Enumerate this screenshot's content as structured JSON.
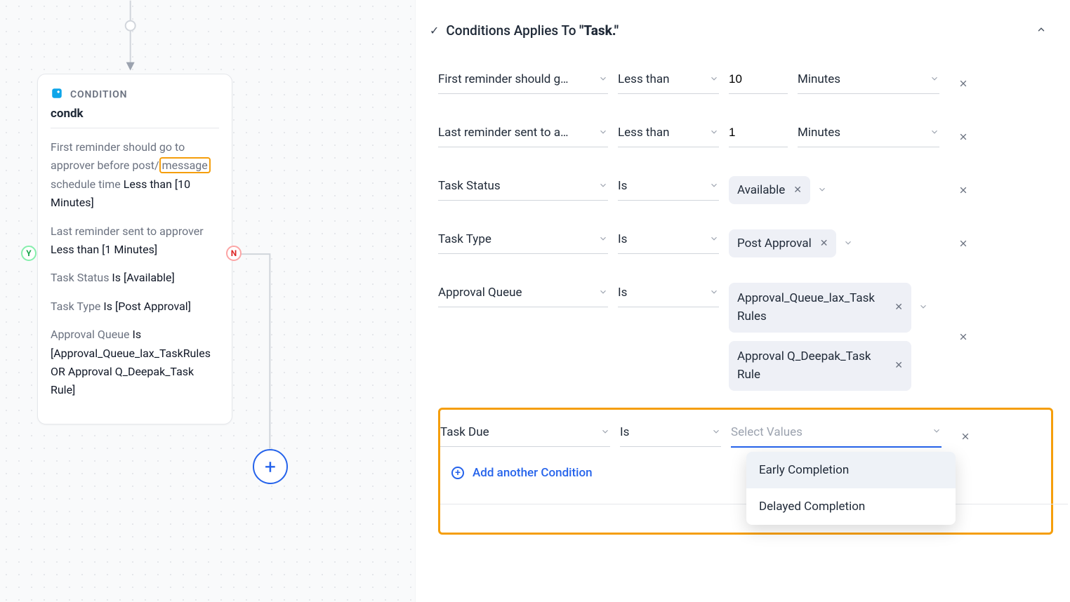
{
  "canvas": {
    "node_type_label": "CONDITION",
    "node_title": "condk",
    "lines": {
      "l1_pre": "First reminder should go to approver before post/",
      "l1_hl": "message",
      "l1_post": " schedule time",
      "l1_val": " Less than [10 Minutes]",
      "l2_key": "Last reminder sent to approver",
      "l2_val": " Less than [1 Minutes]",
      "l3_key": "Task Status",
      "l3_val": " Is [Available]",
      "l4_key": "Task Type",
      "l4_val": " Is [Post Approval]",
      "l5_key": "Approval Queue",
      "l5_val": " Is [Approval_Queue_lax_TaskRules OR Approval Q_Deepak_Task Rule]"
    },
    "y_label": "Y",
    "n_label": "N",
    "add_label": "+"
  },
  "panel": {
    "title_prefix": "Conditions Applies To ",
    "title_quoted": "\"Task.\"",
    "rows": [
      {
        "field": "First reminder should g…",
        "op": "Less than",
        "num": "10",
        "unit": "Minutes"
      },
      {
        "field": "Last reminder sent to a…",
        "op": "Less than",
        "num": "1",
        "unit": "Minutes"
      },
      {
        "field": "Task Status",
        "op": "Is",
        "chips": [
          "Available"
        ]
      },
      {
        "field": "Task Type",
        "op": "Is",
        "chips": [
          "Post Approval"
        ]
      },
      {
        "field": "Approval Queue",
        "op": "Is",
        "chips": [
          "Approval_Queue_lax_Task Rules",
          "Approval Q_Deepak_Task Rule"
        ]
      }
    ],
    "task_due": {
      "field": "Task Due",
      "op": "Is",
      "placeholder": "Select Values"
    },
    "dropdown": [
      "Early Completion",
      "Delayed Completion"
    ],
    "add_condition_label": "Add another Condition"
  }
}
